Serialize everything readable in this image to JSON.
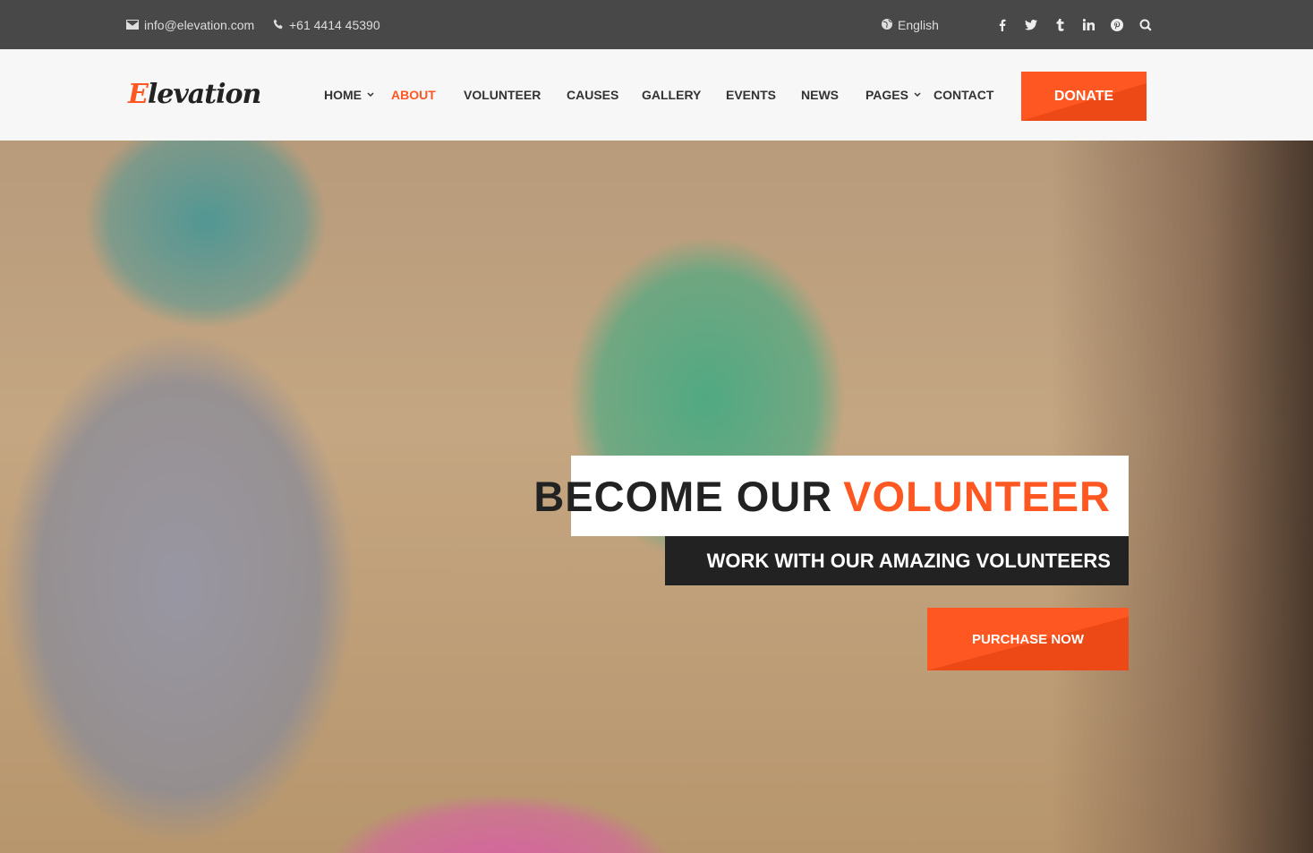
{
  "topbar": {
    "email": "info@elevation.com",
    "phone": "+61 4414 45390",
    "language": "English",
    "socials": [
      "facebook-icon",
      "twitter-icon",
      "tumblr-icon",
      "linkedin-icon",
      "pinterest-icon",
      "search-icon"
    ]
  },
  "header": {
    "logo_first": "E",
    "logo_rest": "levation",
    "nav": [
      {
        "label": "HOME",
        "has_dropdown": true
      },
      {
        "label": "ABOUT",
        "active": true
      },
      {
        "label": "VOLUNTEER"
      },
      {
        "label": "CAUSES"
      },
      {
        "label": "GALLERY"
      },
      {
        "label": "EVENTS"
      },
      {
        "label": "NEWS"
      },
      {
        "label": "PAGES",
        "has_dropdown": true
      },
      {
        "label": "CONTACT"
      }
    ],
    "donate_label": "DONATE"
  },
  "hero": {
    "headline_plain": "BECOME OUR",
    "headline_accent": "VOLUNTEER",
    "subheadline": "WORK WITH OUR AMAZING VOLUNTEERS",
    "cta_label": "PURCHASE NOW"
  },
  "colors": {
    "accent": "#ff5722",
    "topbar_bg": "#484848",
    "dark_box": "#222222"
  }
}
